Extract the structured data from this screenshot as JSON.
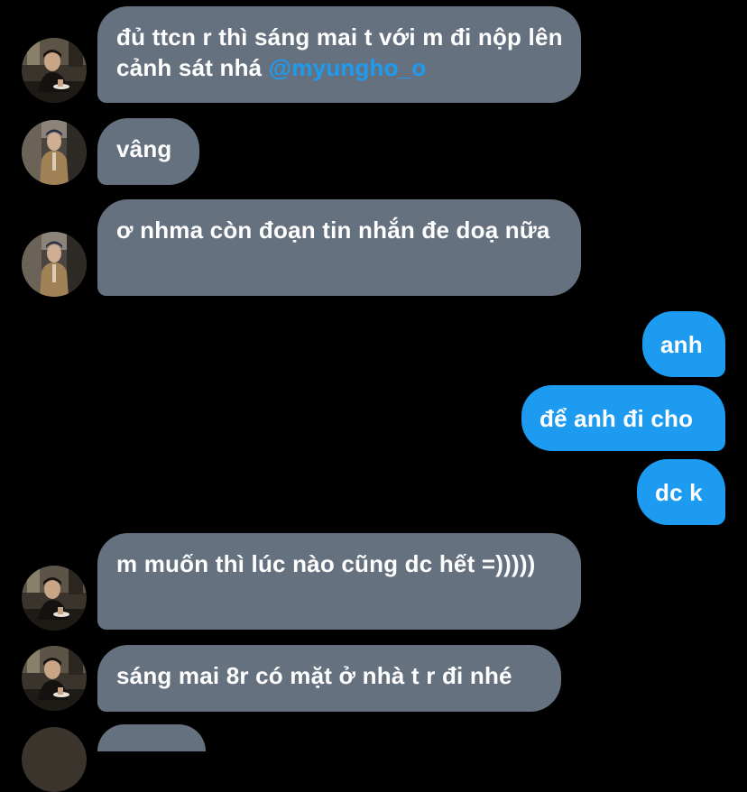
{
  "conversation": {
    "messages": [
      {
        "direction": "incoming",
        "avatar": "avatar-seated-person",
        "text": "đủ ttcn r thì sáng mai t với m đi nộp lên cảnh sát nhá ",
        "mention": "@myungho_o"
      },
      {
        "direction": "incoming",
        "avatar": "avatar-standing-person",
        "text": "vâng"
      },
      {
        "direction": "incoming",
        "avatar": "avatar-standing-person",
        "text": "ơ nhma còn đoạn tin nhắn đe doạ nữa"
      },
      {
        "direction": "outgoing",
        "text": "anh"
      },
      {
        "direction": "outgoing",
        "text": "để anh đi cho"
      },
      {
        "direction": "outgoing",
        "text": "dc k"
      },
      {
        "direction": "incoming",
        "avatar": "avatar-seated-person",
        "text": "m muốn thì lúc nào cũng dc hết =)))))"
      },
      {
        "direction": "incoming",
        "avatar": "avatar-seated-person",
        "text": "sáng mai 8r có mặt ở nhà t r đi nhé"
      }
    ]
  },
  "colors": {
    "background": "#000000",
    "incoming_bubble": "#66717f",
    "outgoing_bubble": "#1d9bf0",
    "mention": "#1d9bf0",
    "text": "#ffffff"
  }
}
